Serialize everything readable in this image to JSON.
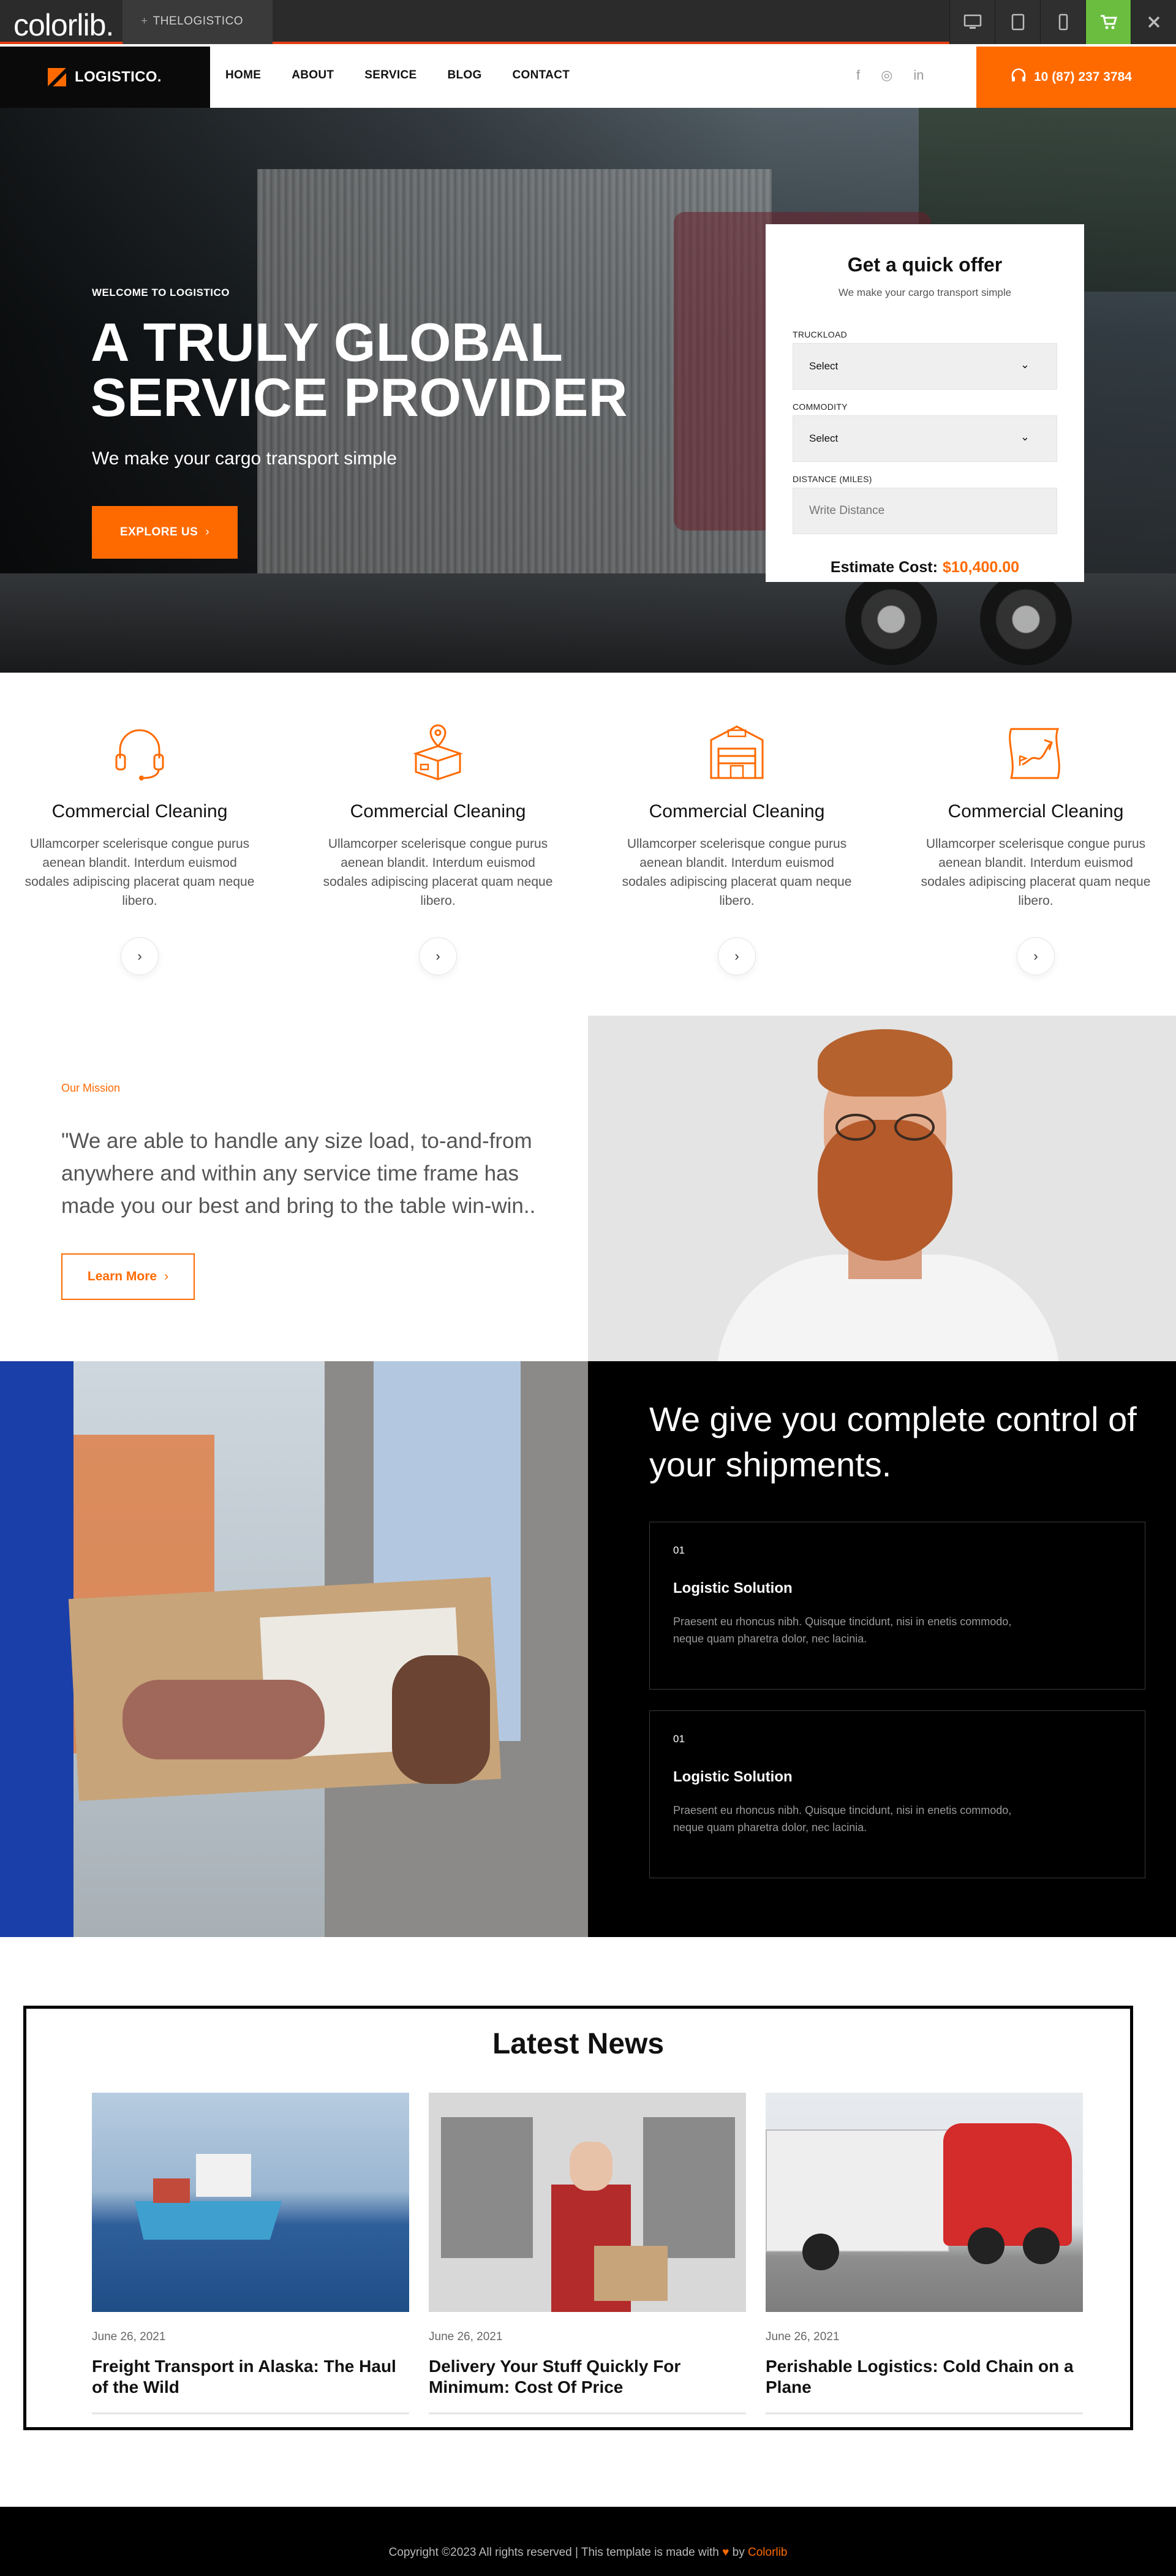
{
  "colorlib_bar": {
    "logo": "colorlib.",
    "tab_label": "THELOGISTICO",
    "devices": [
      "desktop-icon",
      "tablet-icon",
      "mobile-icon",
      "cart-icon",
      "close-icon"
    ],
    "accent": "#6bbd3f"
  },
  "header": {
    "brand": "LOGISTICO.",
    "nav": [
      "HOME",
      "ABOUT",
      "SERVICE",
      "BLOG",
      "CONTACT"
    ],
    "social": [
      "facebook-icon",
      "instagram-icon",
      "linkedin-icon"
    ],
    "phone": "10 (87) 237 3784",
    "accent": "#ff6a00"
  },
  "hero": {
    "kicker": "WELCOME TO LOGISTICO",
    "title": "A TRULY GLOBAL SERVICE PROVIDER",
    "subtitle": "We make your cargo transport simple",
    "button": "EXPLORE US"
  },
  "offer": {
    "title": "Get a quick offer",
    "subtitle": "We make your cargo transport simple",
    "fields": [
      {
        "label": "TRUCKLOAD",
        "value": "Select"
      },
      {
        "label": "COMMODITY",
        "value": "Select"
      },
      {
        "label": "DISTANCE (MILES)",
        "placeholder": "Write Distance"
      }
    ],
    "estimate_label": "Estimate Cost:",
    "estimate_value": "$10,400.00"
  },
  "features": [
    {
      "icon": "headset-icon",
      "title": "Commercial Cleaning",
      "text": "Ullamcorper scelerisque congue purus aenean blandit. Interdum euismod sodales adipiscing placerat quam neque libero."
    },
    {
      "icon": "package-location-icon",
      "title": "Commercial Cleaning",
      "text": "Ullamcorper scelerisque congue purus aenean blandit. Interdum euismod sodales adipiscing placerat quam neque libero."
    },
    {
      "icon": "warehouse-icon",
      "title": "Commercial Cleaning",
      "text": "Ullamcorper scelerisque congue purus aenean blandit. Interdum euismod sodales adipiscing placerat quam neque libero."
    },
    {
      "icon": "route-map-icon",
      "title": "Commercial Cleaning",
      "text": "Ullamcorper scelerisque congue purus aenean blandit. Interdum euismod sodales adipiscing placerat quam neque libero."
    }
  ],
  "mission": {
    "kicker": "Our Mission",
    "quote": "\"We are able to handle any size load, to-and-from anywhere and within any service time frame has made you our best and bring to the table win-win..",
    "button": "Learn More"
  },
  "control": {
    "title": "We give you complete control of your shipments.",
    "cards": [
      {
        "num": "01",
        "title": "Logistic Solution",
        "text": "Praesent eu rhoncus nibh. Quisque tincidunt, nisi in enetis commodo, neque quam pharetra dolor, nec lacinia."
      },
      {
        "num": "01",
        "title": "Logistic Solution",
        "text": "Praesent eu rhoncus nibh. Quisque tincidunt, nisi in enetis commodo, neque quam pharetra dolor, nec lacinia."
      }
    ]
  },
  "news": {
    "title": "Latest News",
    "posts": [
      {
        "date": "June 26, 2021",
        "title": "Freight Transport in Alaska: The Haul of the Wild"
      },
      {
        "date": "June 26, 2021",
        "title": "Delivery Your Stuff Quickly For Minimum: Cost Of Price"
      },
      {
        "date": "June 26, 2021",
        "title": "Perishable Logistics: Cold Chain on a Plane"
      }
    ]
  },
  "footer": {
    "text_before": "Copyright ©2023 All rights reserved | This template is made with",
    "by": "by",
    "link": "Colorlib"
  }
}
